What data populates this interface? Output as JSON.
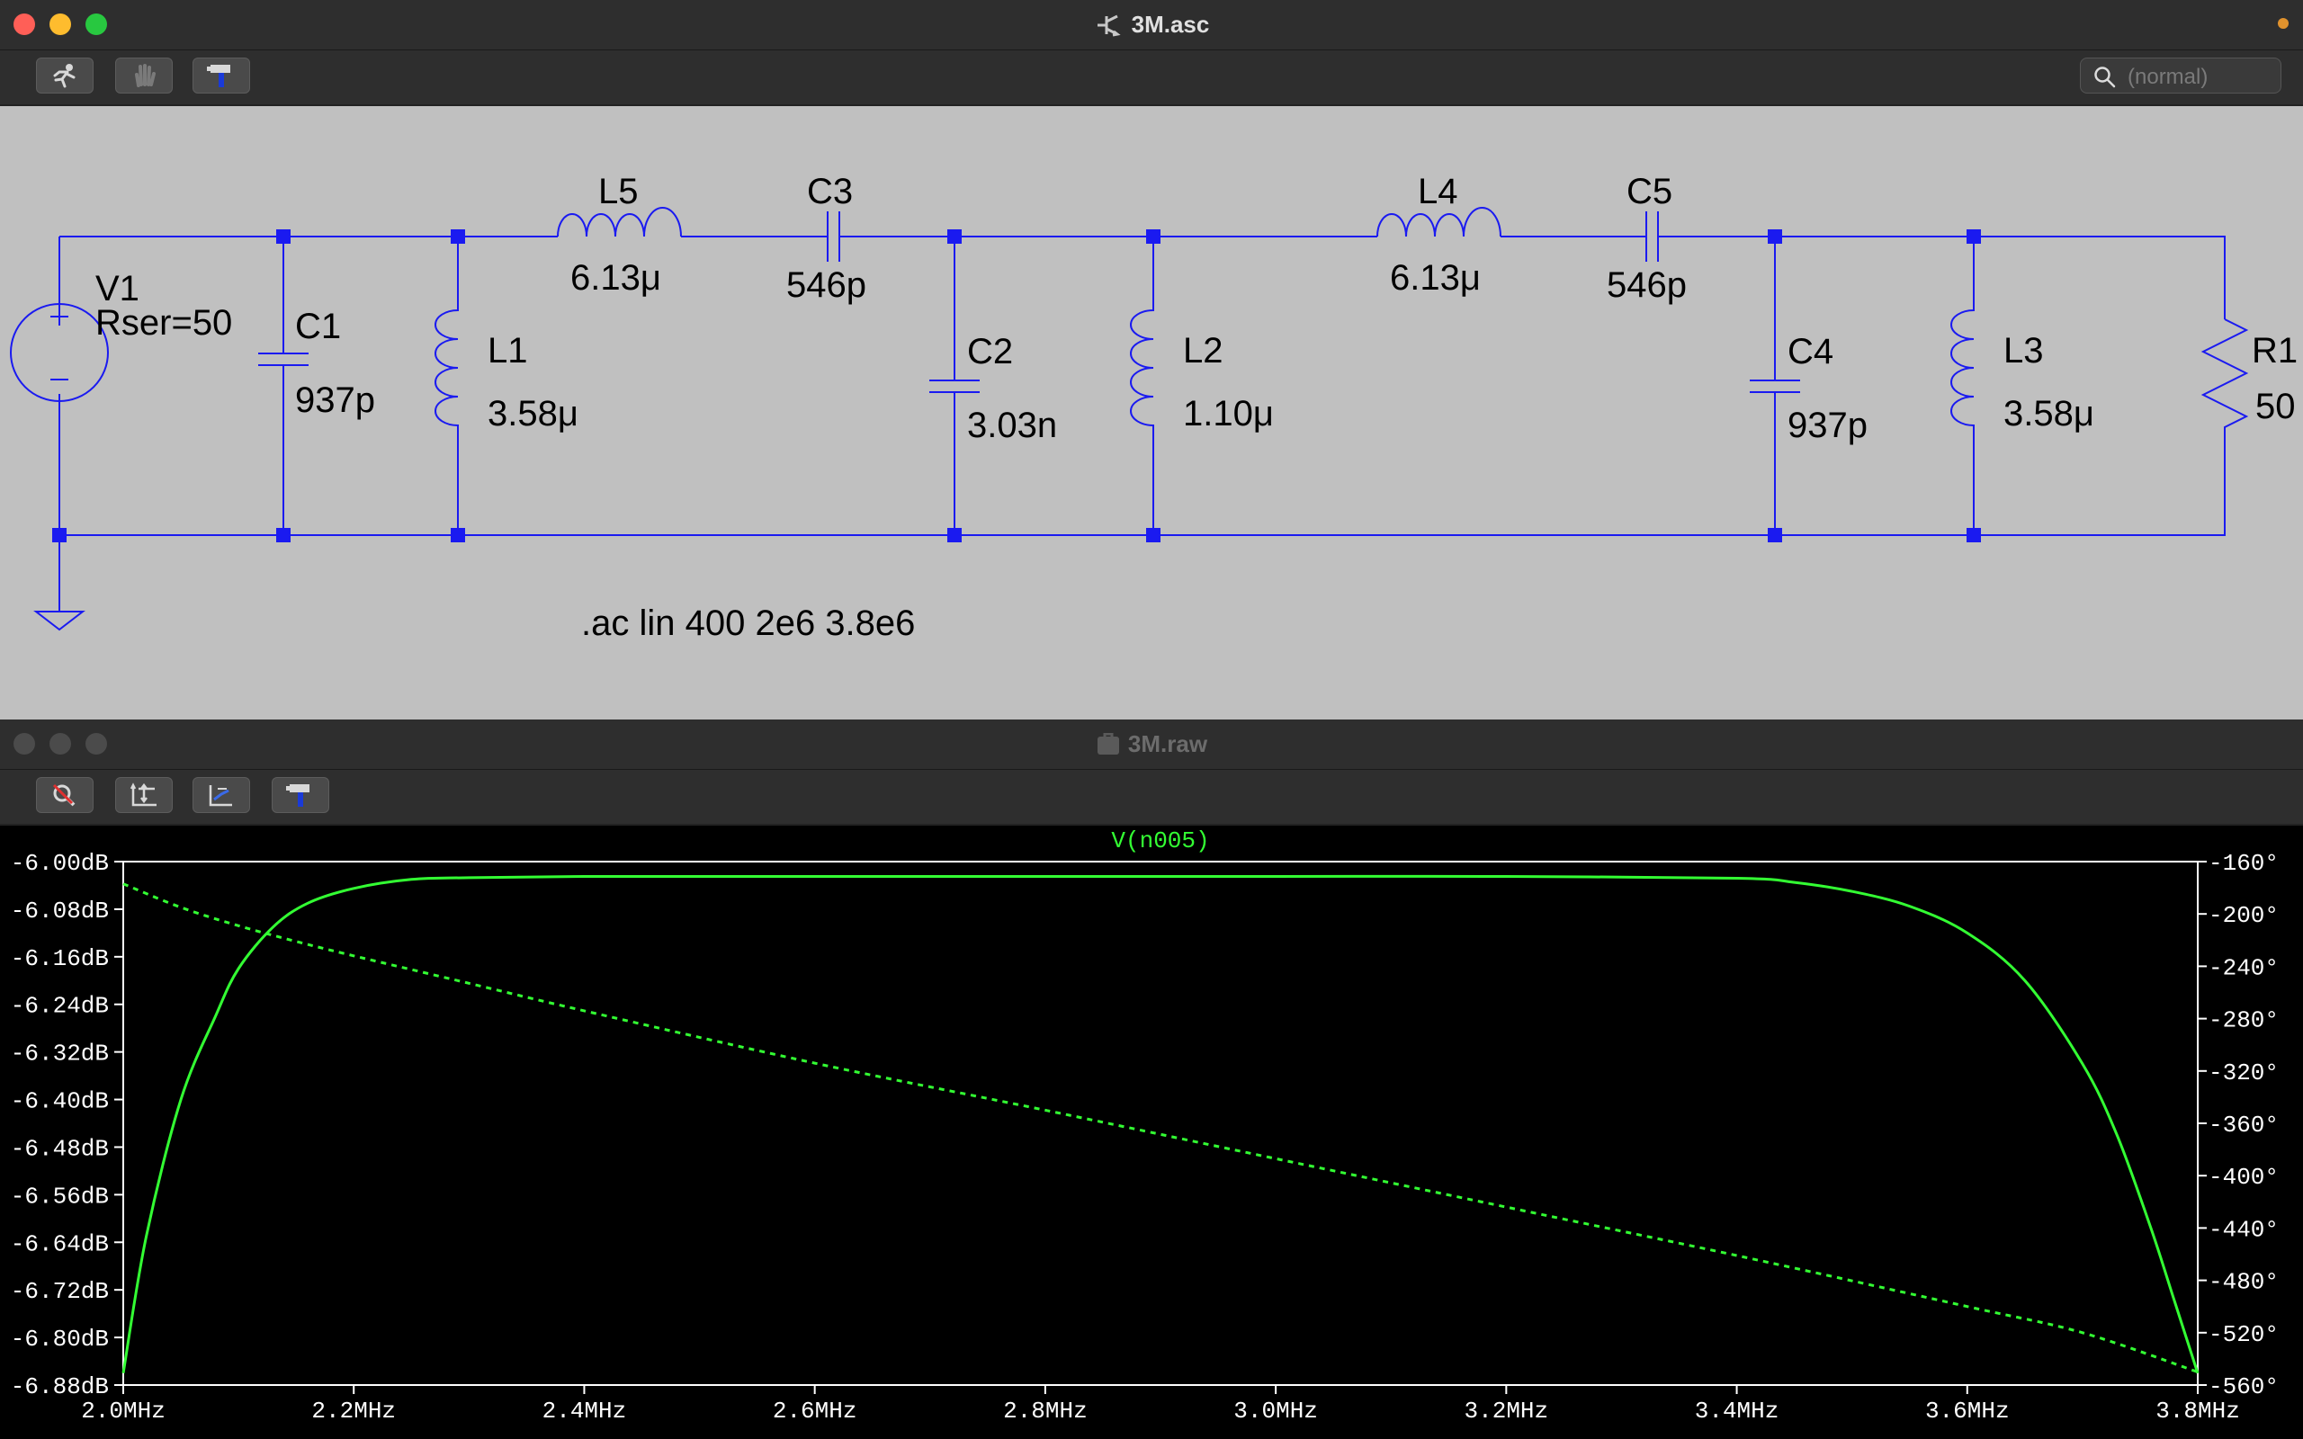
{
  "schematic_window": {
    "title": "3M.asc",
    "search_placeholder": "(normal)",
    "toolbar": [
      "run-icon",
      "halt-icon",
      "control-panel-icon"
    ],
    "components": {
      "V1": {
        "name": "V1",
        "value": "Rser=50"
      },
      "C1": {
        "name": "C1",
        "value": "937p"
      },
      "L1": {
        "name": "L1",
        "value": "3.58μ"
      },
      "L5": {
        "name": "L5",
        "value": "6.13μ"
      },
      "C3": {
        "name": "C3",
        "value": "546p"
      },
      "C2": {
        "name": "C2",
        "value": "3.03n"
      },
      "L2": {
        "name": "L2",
        "value": "1.10μ"
      },
      "L4": {
        "name": "L4",
        "value": "6.13μ"
      },
      "C5": {
        "name": "C5",
        "value": "546p"
      },
      "C4": {
        "name": "C4",
        "value": "937p"
      },
      "L3": {
        "name": "L3",
        "value": "3.58μ"
      },
      "R1": {
        "name": "R1",
        "value": "50"
      }
    },
    "directive": ".ac lin 400 2e6 3.8e6",
    "wire_color": "#1a1af0"
  },
  "plot_window": {
    "title": "3M.raw",
    "toolbar": [
      "autorange-icon",
      "axis-icon",
      "cursor-icon",
      "control-panel-icon"
    ],
    "trace_label": "V(n005)",
    "trace_color": "#33ff33",
    "left_ticks": [
      "-6.00dB",
      "-6.08dB",
      "-6.16dB",
      "-6.24dB",
      "-6.32dB",
      "-6.40dB",
      "-6.48dB",
      "-6.56dB",
      "-6.64dB",
      "-6.72dB",
      "-6.80dB",
      "-6.88dB"
    ],
    "right_ticks": [
      "-160°",
      "-200°",
      "-240°",
      "-280°",
      "-320°",
      "-360°",
      "-400°",
      "-440°",
      "-480°",
      "-520°",
      "-560°"
    ],
    "x_ticks": [
      "2.0MHz",
      "2.2MHz",
      "2.4MHz",
      "2.6MHz",
      "2.8MHz",
      "3.0MHz",
      "3.2MHz",
      "3.4MHz",
      "3.6MHz",
      "3.8MHz"
    ]
  },
  "chart_data": {
    "type": "line",
    "title": "V(n005)",
    "xlabel": "",
    "ylabel": "",
    "xlim": [
      2.0,
      3.8
    ],
    "ylim": [
      -6.88,
      -6.0
    ],
    "y2lim": [
      -560,
      -160
    ],
    "series": [
      {
        "name": "V(n005)",
        "axis": "left",
        "style": "solid",
        "x": [
          2.0,
          2.02,
          2.05,
          2.08,
          2.1,
          2.13,
          2.16,
          2.2,
          2.25,
          2.3,
          2.4,
          2.6,
          2.8,
          3.0,
          3.2,
          3.4,
          3.45,
          3.5,
          3.55,
          3.6,
          3.65,
          3.7,
          3.73,
          3.76,
          3.78,
          3.8
        ],
        "y": [
          -6.86,
          -6.63,
          -6.4,
          -6.26,
          -6.18,
          -6.11,
          -6.07,
          -6.045,
          -6.03,
          -6.027,
          -6.025,
          -6.025,
          -6.025,
          -6.025,
          -6.025,
          -6.028,
          -6.035,
          -6.05,
          -6.075,
          -6.12,
          -6.2,
          -6.34,
          -6.46,
          -6.62,
          -6.74,
          -6.86
        ]
      },
      {
        "name": "V(n005)",
        "axis": "right",
        "style": "dashed",
        "x": [
          2.0,
          2.05,
          2.1,
          2.15,
          2.2,
          2.3,
          2.4,
          2.6,
          2.8,
          3.0,
          3.2,
          3.4,
          3.6,
          3.7,
          3.8
        ],
        "y": [
          -177,
          -195,
          -209,
          -221,
          -232,
          -253,
          -274,
          -314,
          -350,
          -387,
          -424,
          -461,
          -500,
          -520,
          -550
        ]
      }
    ]
  }
}
